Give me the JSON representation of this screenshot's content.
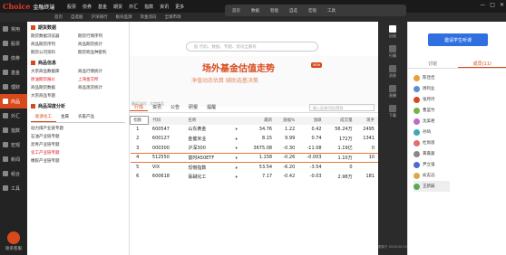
{
  "app": {
    "logo_brand": "Choice",
    "logo_cn": "金融终端",
    "menu": [
      "股票",
      "债券",
      "基金",
      "期货",
      "外汇",
      "指数",
      "资讯",
      "更多"
    ],
    "subtabs": [
      "首页",
      "自选股",
      "沪深排行",
      "板块监测",
      "资金流向",
      "全球市场"
    ],
    "overlay": [
      "首页",
      "数据",
      "智能",
      "自选",
      "宏观",
      "工具"
    ],
    "window_controls": [
      "—",
      "□",
      "✕"
    ]
  },
  "sidebar": {
    "items": [
      "常用",
      "股票",
      "债券",
      "基金",
      "理财",
      "商品",
      "外汇",
      "指数",
      "宏观",
      "新闻",
      "组合",
      "工具"
    ],
    "active_index": 5,
    "bottom_label": "联系客服"
  },
  "navpanel": {
    "sec1_title": "期货数据",
    "sec1_items": [
      "期货数据浏览器",
      "期货行情序列",
      "商品期货序列",
      "商品期货统计",
      "期货公司资料",
      "期货跨品种套利"
    ],
    "sec2_title": "商品信息",
    "sec2_items": [
      "大宗商品数据库",
      "商品行情统计",
      "原油期货报价",
      "上海金交所",
      "商品期货数据",
      "商品现货统计",
      "大宗商品专题",
      ""
    ],
    "sec2_red": [
      2,
      3
    ],
    "sec3_title": "商品深度分析",
    "tabs": [
      "能源化工",
      "金属",
      "农畜产品"
    ],
    "list": [
      "动力煤产业链专题",
      "石油产业链专题",
      "沥青产业链专题",
      "化工产业链专题",
      "橡胶产业链专题"
    ]
  },
  "main": {
    "search_placeholder": "股 代码、数据、专题、资讯全都有",
    "banner_title": "场外基金估值走势",
    "banner_new": "NEW",
    "banner_sub": "净值动态估算    辅助选基决策",
    "hot_search": "最近访问：大宗商品",
    "quote_tabs": [
      "行情",
      "资讯",
      "公告",
      "研报",
      "提醒"
    ],
    "quote_search_placeholder": "输入证券代码/简称",
    "columns": [
      "指数",
      "代码",
      "名称",
      "",
      "最新",
      "涨幅%",
      "涨跌",
      "成交量",
      "现手"
    ],
    "rows": [
      {
        "no": "1",
        "code": "600547",
        "name": "山东黄金",
        "price": "34.76",
        "pct": "1.22",
        "chg": "0.42",
        "vol": "56.24万",
        "hand": "2495",
        "dir": "up"
      },
      {
        "no": "2",
        "code": "600127",
        "name": "金健米业",
        "price": "8.15",
        "pct": "9.99",
        "chg": "0.74",
        "vol": "172万",
        "hand": "1341",
        "dir": "up"
      },
      {
        "no": "3",
        "code": "000300",
        "name": "沪深300",
        "price": "3675.08",
        "pct": "-0.30",
        "chg": "-11.08",
        "vol": "1.19亿",
        "hand": "0",
        "dir": "dn"
      },
      {
        "no": "4",
        "code": "512550",
        "name": "富时A50ETF",
        "price": "1.158",
        "pct": "-0.26",
        "chg": "-0.003",
        "vol": "1.10万",
        "hand": "10",
        "dir": "dn"
      },
      {
        "no": "5",
        "code": "VIX",
        "name": "恐慌指数",
        "price": "53.54",
        "pct": "-6.20",
        "chg": "-3.54",
        "vol": "0",
        "hand": "",
        "dir": "dn"
      },
      {
        "no": "6",
        "code": "600618",
        "name": "氯碱化工",
        "price": "7.17",
        "pct": "-0.42",
        "chg": "-0.03",
        "vol": "2.98万",
        "hand": "181",
        "dir": "dn"
      }
    ]
  },
  "rtool": {
    "items": [
      "自选",
      "行情",
      "消息",
      "直播",
      "下载"
    ],
    "bottom": "更新于 2018.09.25"
  },
  "rpanel": {
    "button": "邀请学生听课",
    "tabs": [
      "讨论",
      "成员(11)"
    ],
    "users": [
      "陈佳佳",
      "周鸣业",
      "张月玲",
      "曹蓝竹",
      "沈美君",
      "孙琦",
      "杜尚恩",
      "黄嘉骏",
      "尹立强",
      "俞志滔",
      "王新辰"
    ],
    "user_colors": [
      "#e8a03a",
      "#5a8fd8",
      "#d84a1b",
      "#7ab04a",
      "#c06ac8",
      "#3aa8b8",
      "#e07070",
      "#888888",
      "#4a6ad8",
      "#d8a84a",
      "#5aa85a"
    ]
  },
  "colors": {
    "accent": "#d84a1b",
    "up": "#d8202a",
    "down": "#0a8a2a",
    "blue_button": "#2f6fe0"
  }
}
